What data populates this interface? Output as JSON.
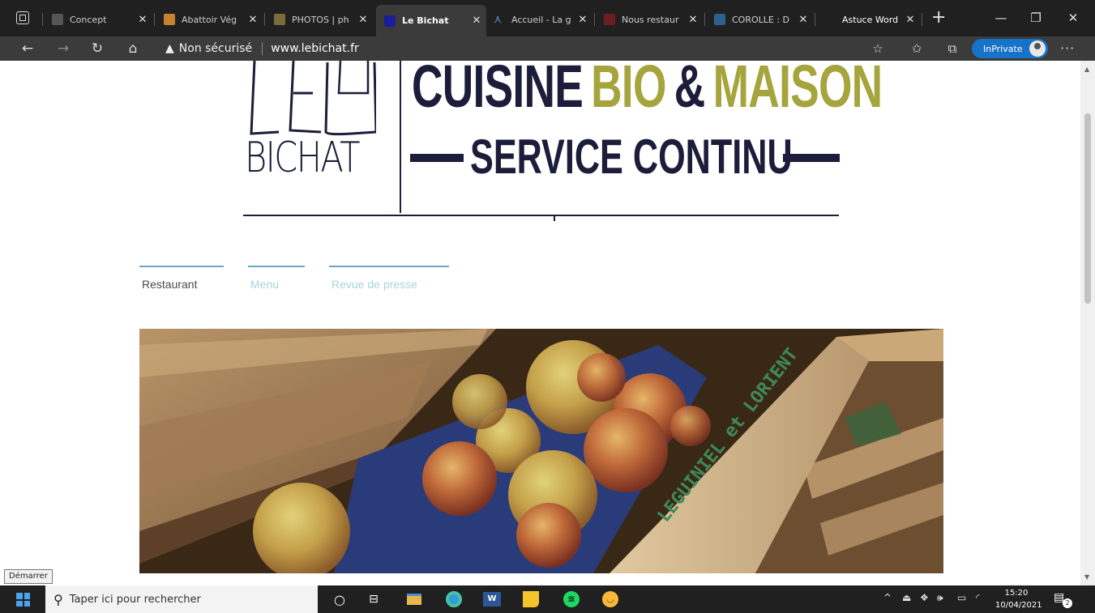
{
  "browser": {
    "tabs": [
      {
        "title": "Concept",
        "favicon_color": "#555555"
      },
      {
        "title": "Abattoir Vég",
        "favicon_color": "#c9812e"
      },
      {
        "title": "PHOTOS | ph",
        "favicon_color": "#7a6b3a"
      },
      {
        "title": "Le Bichat",
        "favicon_color": "#1b1d9a",
        "active": true
      },
      {
        "title": "Accueil - La g",
        "favicon_color": "#4c8ed1"
      },
      {
        "title": "Nous restaur",
        "favicon_color": "#6b1f24"
      },
      {
        "title": "COROLLE : D",
        "favicon_color": "#2e5f8f"
      },
      {
        "title": "Astuce Word",
        "favicon_color": "#202020"
      }
    ],
    "new_tab_symbol": "+",
    "address": {
      "security_label": "Non sécurisé",
      "url": "www.lebichat.fr"
    },
    "inprivate_label": "InPrivate",
    "menu_symbol": "···"
  },
  "site": {
    "logo": {
      "le": "LE",
      "bichat": "BICHAT",
      "tagline_cuisine": "CUISINE",
      "tagline_bio": "BIO",
      "tagline_amp": "&",
      "tagline_maison": "MAISON",
      "service": "SERVICE CONTINU",
      "navy": "#1b1d3a",
      "olive": "#a6a43c"
    },
    "nav": [
      {
        "label": "Restaurant",
        "active": true
      },
      {
        "label": "Menu",
        "active": false
      },
      {
        "label": "Revue de presse",
        "active": false
      }
    ],
    "hero": {
      "crate_lettering": "LEGUINIEL et LORIENT"
    }
  },
  "taskbar": {
    "start_tooltip": "Démarrer",
    "search_placeholder": "Taper ici pour rechercher",
    "tray_arrow": "^",
    "clock": {
      "time": "15:20",
      "date": "10/04/2021"
    },
    "notification_count": "2"
  }
}
